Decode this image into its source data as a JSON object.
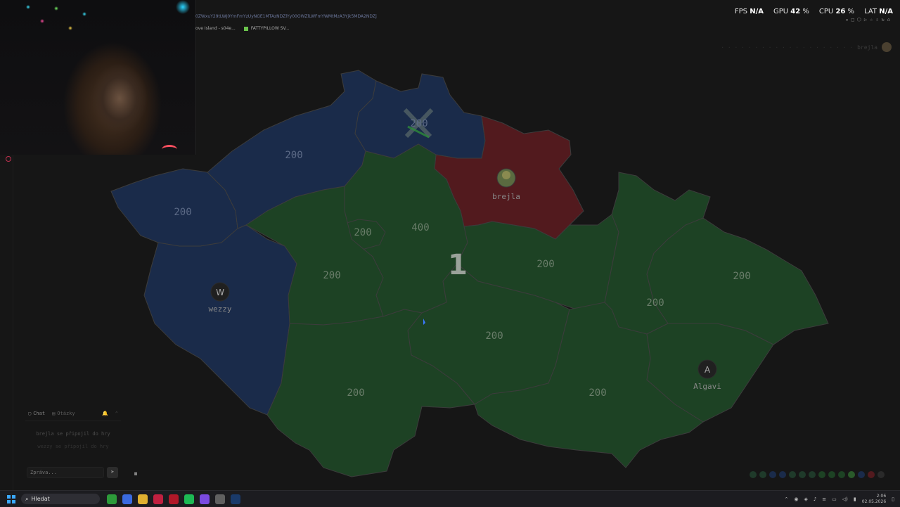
{
  "browser": {
    "url_fragment": "0ZWxuY29tLWJ0YmFmYzUyNGE1MTAzNDZlYy00OWZlLWFmYWMtMzA3Yjk5MDA2NDZj",
    "tabs": [
      "ove Island - s04e...",
      "FATTYPILLOW SV..."
    ]
  },
  "overlay": {
    "fps_label": "FPS",
    "fps_value": "N/A",
    "gpu_label": "GPU",
    "gpu_value": "42",
    "cpu_label": "CPU",
    "cpu_value": "26",
    "percent_sign": "%",
    "lat_label": "LAT",
    "lat_value": "N/A"
  },
  "header": {
    "user_name": "brejla"
  },
  "game": {
    "round_number": "1",
    "regions": [
      {
        "id": "karlovarsky",
        "value": "200",
        "owner": "wezzy"
      },
      {
        "id": "ustecky",
        "value": "200",
        "owner": "wezzy"
      },
      {
        "id": "liberecky",
        "value": "200",
        "owner": "wezzy"
      },
      {
        "id": "plzensky",
        "value": "",
        "owner": "wezzy"
      },
      {
        "id": "kralovehradecky",
        "value": "",
        "owner": "brejla"
      },
      {
        "id": "praha",
        "value": "200",
        "owner": "Algavi"
      },
      {
        "id": "stredocesky",
        "value": "400",
        "owner": "Algavi"
      },
      {
        "id": "stredocesky-west",
        "value": "200",
        "owner": "Algavi"
      },
      {
        "id": "pardubicky",
        "value": "200",
        "owner": "Algavi"
      },
      {
        "id": "olomoucky",
        "value": "200",
        "owner": "Algavi"
      },
      {
        "id": "moravskoslezsky",
        "value": "200",
        "owner": "Algavi"
      },
      {
        "id": "vysocina",
        "value": "200",
        "owner": "Algavi"
      },
      {
        "id": "jihocesky",
        "value": "200",
        "owner": "Algavi"
      },
      {
        "id": "jihomoravsky",
        "value": "200",
        "owner": "Algavi"
      },
      {
        "id": "zlinsky",
        "value": "",
        "owner": "Algavi"
      }
    ],
    "players": [
      {
        "name": "wezzy",
        "initial": "W"
      },
      {
        "name": "brejla",
        "initial": ""
      },
      {
        "name": "Algavi",
        "initial": "A"
      }
    ],
    "colors": {
      "wezzy": "#1a2b4a",
      "brejla": "#521a1e",
      "Algavi": "#1d4224"
    }
  },
  "chat": {
    "tab_chat": "Chat",
    "tab_questions": "Otázky",
    "messages": [
      "brejla se připojil do hry",
      "wezzy se připojil do hry"
    ],
    "input_placeholder": "Zpráva..."
  },
  "status_dots": [
    "#1f3a2a",
    "#1f3a2a",
    "#1a2b4a",
    "#1a2b4a",
    "#1f3a2a",
    "#1f3a2a",
    "#1f3a2a",
    "#1d4224",
    "#1d4224",
    "#1d4224",
    "#2a5a2a",
    "#1a2b4a",
    "#521a1e",
    "#2a2a2a"
  ],
  "taskbar": {
    "search_label": "Hledat",
    "time": "2:06",
    "date": "02.05.2026"
  }
}
